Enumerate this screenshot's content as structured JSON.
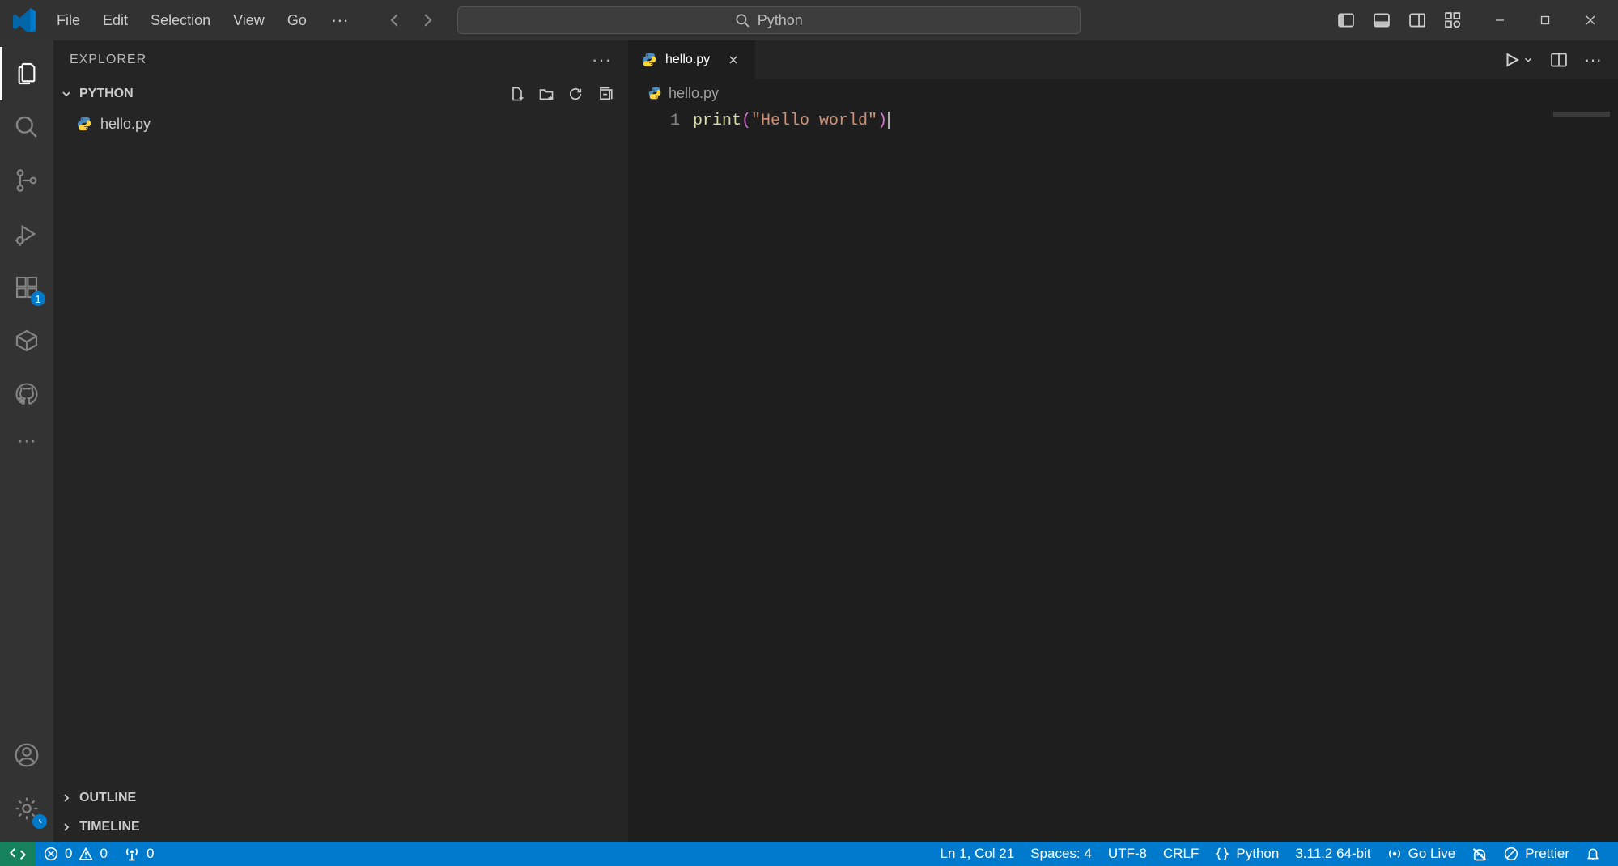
{
  "titlebar": {
    "menu": [
      "File",
      "Edit",
      "Selection",
      "View",
      "Go"
    ],
    "search_placeholder": "Python"
  },
  "activity": {
    "extensions_badge": "1"
  },
  "sidebar": {
    "title": "EXPLORER",
    "folder": "PYTHON",
    "files": [
      "hello.py"
    ],
    "outline": "OUTLINE",
    "timeline": "TIMELINE"
  },
  "tabs": {
    "active": "hello.py"
  },
  "breadcrumbs": {
    "file": "hello.py"
  },
  "editor": {
    "line_number": "1",
    "code_fn": "print",
    "code_open": "(",
    "code_str": "\"Hello world\"",
    "code_close": ")"
  },
  "status": {
    "errors": "0",
    "warnings": "0",
    "ports": "0",
    "cursor": "Ln 1, Col 21",
    "spaces": "Spaces: 4",
    "encoding": "UTF-8",
    "eol": "CRLF",
    "language": "Python",
    "interpreter": "3.11.2 64-bit",
    "golive": "Go Live",
    "prettier": "Prettier"
  }
}
